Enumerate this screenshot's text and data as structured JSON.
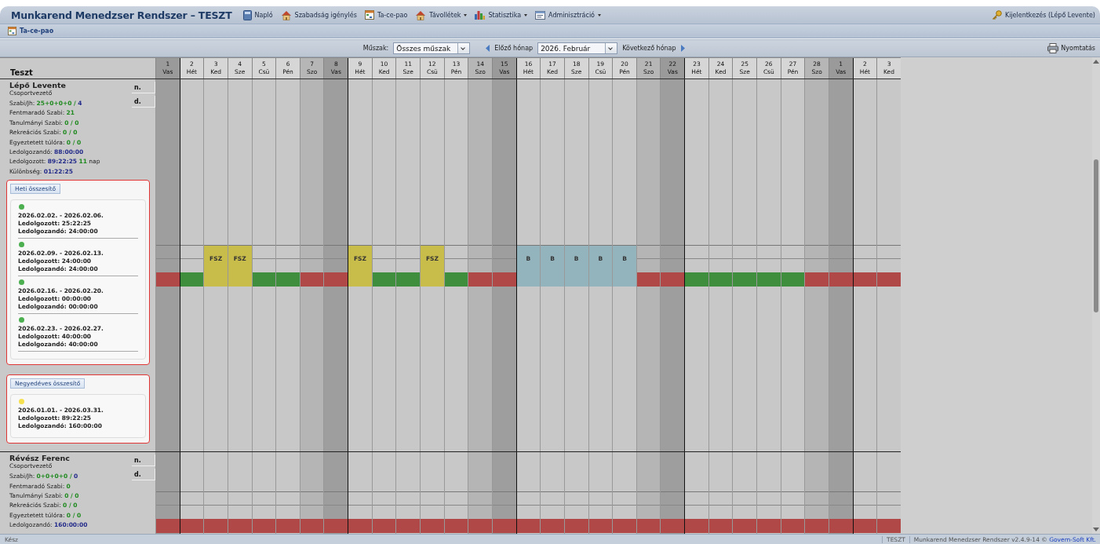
{
  "app_title": "Munkarend Menedzser Rendszer – TESZT",
  "menu": [
    {
      "label": "Napló",
      "dropdown": false
    },
    {
      "label": "Szabadság igénylés",
      "dropdown": false
    },
    {
      "label": "Ta-ce-pao",
      "dropdown": false
    },
    {
      "label": "Távollétek",
      "dropdown": true
    },
    {
      "label": "Statisztika",
      "dropdown": true
    },
    {
      "label": "Adminisztráció",
      "dropdown": true
    }
  ],
  "logout": "Kijelentkezés (Lépő Levente)",
  "tab": "Ta-ce-pao",
  "filters": {
    "shift_label": "Műszak:",
    "shift_value": "Összes műszak",
    "prev": "Előző hónap",
    "month": "2026. Február",
    "next": "Következő hónap",
    "print": "Nyomtatás"
  },
  "grid": {
    "group": "Teszt",
    "days": [
      {
        "num": "1",
        "name": "Vas",
        "kind": "sunday"
      },
      {
        "num": "2",
        "name": "Hét",
        "kind": "weekday"
      },
      {
        "num": "3",
        "name": "Ked",
        "kind": "weekday"
      },
      {
        "num": "4",
        "name": "Sze",
        "kind": "weekday"
      },
      {
        "num": "5",
        "name": "Csü",
        "kind": "weekday"
      },
      {
        "num": "6",
        "name": "Pén",
        "kind": "weekday"
      },
      {
        "num": "7",
        "name": "Szo",
        "kind": "saturday"
      },
      {
        "num": "8",
        "name": "Vas",
        "kind": "sunday"
      },
      {
        "num": "9",
        "name": "Hét",
        "kind": "weekday"
      },
      {
        "num": "10",
        "name": "Ked",
        "kind": "weekday"
      },
      {
        "num": "11",
        "name": "Sze",
        "kind": "weekday"
      },
      {
        "num": "12",
        "name": "Csü",
        "kind": "weekday"
      },
      {
        "num": "13",
        "name": "Pén",
        "kind": "weekday"
      },
      {
        "num": "14",
        "name": "Szo",
        "kind": "saturday"
      },
      {
        "num": "15",
        "name": "Vas",
        "kind": "sunday"
      },
      {
        "num": "16",
        "name": "Hét",
        "kind": "weekday"
      },
      {
        "num": "17",
        "name": "Ked",
        "kind": "weekday"
      },
      {
        "num": "18",
        "name": "Sze",
        "kind": "weekday"
      },
      {
        "num": "19",
        "name": "Csü",
        "kind": "weekday"
      },
      {
        "num": "20",
        "name": "Pén",
        "kind": "weekday"
      },
      {
        "num": "21",
        "name": "Szo",
        "kind": "saturday"
      },
      {
        "num": "22",
        "name": "Vas",
        "kind": "sunday"
      },
      {
        "num": "23",
        "name": "Hét",
        "kind": "weekday"
      },
      {
        "num": "24",
        "name": "Ked",
        "kind": "weekday"
      },
      {
        "num": "25",
        "name": "Sze",
        "kind": "weekday"
      },
      {
        "num": "26",
        "name": "Csü",
        "kind": "weekday"
      },
      {
        "num": "27",
        "name": "Pén",
        "kind": "weekday"
      },
      {
        "num": "28",
        "name": "Szo",
        "kind": "saturday"
      },
      {
        "num": "1",
        "name": "Vas",
        "kind": "sunday"
      },
      {
        "num": "2",
        "name": "Hét",
        "kind": "weekday"
      },
      {
        "num": "3",
        "name": "Ked",
        "kind": "weekday"
      }
    ]
  },
  "employees": [
    {
      "name": "Lépő Levente",
      "role": "Csoportvezető",
      "buttons": [
        "n.",
        "d."
      ],
      "stats": [
        {
          "label": "Szabi/Jh:",
          "parts": [
            {
              "text": "25+0+0+0 /",
              "kind": "green"
            },
            {
              "text": "4",
              "kind": "blue"
            }
          ]
        },
        {
          "label": "Fentmaradó Szabi:",
          "parts": [
            {
              "text": "21",
              "kind": "green"
            }
          ]
        },
        {
          "label": "Tanulmányi Szabi:",
          "parts": [
            {
              "text": "0 / 0",
              "kind": "green"
            }
          ]
        },
        {
          "label": "Rekreációs Szabi:",
          "parts": [
            {
              "text": "0 / 0",
              "kind": "green"
            }
          ]
        },
        {
          "label": "Egyeztetett túlóra:",
          "parts": [
            {
              "text": "0 / 0",
              "kind": "green"
            }
          ]
        },
        {
          "label": "Ledolgozandó:",
          "parts": [
            {
              "text": "88:00:00",
              "kind": "blue"
            }
          ]
        },
        {
          "label": "Ledolgozott:",
          "parts": [
            {
              "text": "89:22:25",
              "kind": "blue"
            },
            {
              "text": "11",
              "kind": "green"
            },
            {
              "text": "nap",
              "kind": "plain"
            }
          ]
        },
        {
          "label": "Különbség:",
          "parts": [
            {
              "text": "01:22:25",
              "kind": "blue"
            }
          ]
        }
      ],
      "summaries": [
        {
          "title": "Heti összesítő",
          "entries": [
            {
              "color": "#4caf50",
              "period": "2026.02.02. - 2026.02.06.",
              "worked": "Ledolgozott: 25:22:25",
              "required": "Ledolgozandó: 24:00:00"
            },
            {
              "color": "#4caf50",
              "period": "2026.02.09. - 2026.02.13.",
              "worked": "Ledolgozott: 24:00:00",
              "required": "Ledolgozandó: 24:00:00"
            },
            {
              "color": "#4caf50",
              "period": "2026.02.16. - 2026.02.20.",
              "worked": "Ledolgozott: 00:00:00",
              "required": "Ledolgozandó: 00:00:00"
            },
            {
              "color": "#4caf50",
              "period": "2026.02.23. - 2026.02.27.",
              "worked": "Ledolgozott: 40:00:00",
              "required": "Ledolgozandó: 40:00:00"
            }
          ]
        },
        {
          "title": "Negyedéves összesítő",
          "entries": [
            {
              "color": "#f5e050",
              "period": "2026.01.01. - 2026.03.31.",
              "worked": "Ledolgozott: 89:22:25",
              "required": "Ledolgozandó: 160:00:00"
            }
          ]
        }
      ],
      "days": [
        {
          "color": "#b04848"
        },
        {
          "color": "#3e8e3e"
        },
        {
          "label": "FSZ",
          "color": "#c8bc4a"
        },
        {
          "label": "FSZ",
          "color": "#c8bc4a"
        },
        {
          "color": "#3e8e3e"
        },
        {
          "color": "#3e8e3e"
        },
        {
          "color": "#b04848"
        },
        {
          "color": "#b04848"
        },
        {
          "label": "FSZ",
          "color": "#c8bc4a"
        },
        {
          "color": "#3e8e3e"
        },
        {
          "color": "#3e8e3e"
        },
        {
          "label": "FSZ",
          "color": "#c8bc4a"
        },
        {
          "color": "#3e8e3e"
        },
        {
          "color": "#b04848"
        },
        {
          "color": "#b04848"
        },
        {
          "label": "B",
          "color": "#93b3bd"
        },
        {
          "label": "B",
          "color": "#93b3bd"
        },
        {
          "label": "B",
          "color": "#93b3bd"
        },
        {
          "label": "B",
          "color": "#93b3bd"
        },
        {
          "label": "B",
          "color": "#93b3bd"
        },
        {
          "color": "#b04848"
        },
        {
          "color": "#b04848"
        },
        {
          "color": "#3e8e3e"
        },
        {
          "color": "#3e8e3e"
        },
        {
          "color": "#3e8e3e"
        },
        {
          "color": "#3e8e3e"
        },
        {
          "color": "#3e8e3e"
        },
        {
          "color": "#b04848"
        },
        {
          "color": "#b04848"
        },
        {
          "color": "#b04848"
        },
        {
          "color": "#b04848"
        }
      ]
    },
    {
      "name": "Révész Ferenc",
      "role": "Csoportvezető",
      "buttons": [
        "n.",
        "d."
      ],
      "stats": [
        {
          "label": "Szabi/Jh:",
          "parts": [
            {
              "text": "0+0+0+0 /",
              "kind": "green"
            },
            {
              "text": "0",
              "kind": "blue"
            }
          ]
        },
        {
          "label": "Fentmaradó Szabi:",
          "parts": [
            {
              "text": "0",
              "kind": "green"
            }
          ]
        },
        {
          "label": "Tanulmányi Szabi:",
          "parts": [
            {
              "text": "0 / 0",
              "kind": "green"
            }
          ]
        },
        {
          "label": "Rekreációs Szabi:",
          "parts": [
            {
              "text": "0 / 0",
              "kind": "green"
            }
          ]
        },
        {
          "label": "Egyeztetett túlóra:",
          "parts": [
            {
              "text": "0 / 0",
              "kind": "green"
            }
          ]
        },
        {
          "label": "Ledolgozandó:",
          "parts": [
            {
              "text": "160:00:00",
              "kind": "blue"
            }
          ]
        }
      ],
      "days": [
        {
          "color": "#b04848"
        },
        {
          "color": "#b04848"
        },
        {
          "color": "#b04848"
        },
        {
          "color": "#b04848"
        },
        {
          "color": "#b04848"
        },
        {
          "color": "#b04848"
        },
        {
          "color": "#b04848"
        },
        {
          "color": "#b04848"
        },
        {
          "color": "#b04848"
        },
        {
          "color": "#b04848"
        },
        {
          "color": "#b04848"
        },
        {
          "color": "#b04848"
        },
        {
          "color": "#b04848"
        },
        {
          "color": "#b04848"
        },
        {
          "color": "#b04848"
        },
        {
          "color": "#b04848"
        },
        {
          "color": "#b04848"
        },
        {
          "color": "#b04848"
        },
        {
          "color": "#b04848"
        },
        {
          "color": "#b04848"
        },
        {
          "color": "#b04848"
        },
        {
          "color": "#b04848"
        },
        {
          "color": "#b04848"
        },
        {
          "color": "#b04848"
        },
        {
          "color": "#b04848"
        },
        {
          "color": "#b04848"
        },
        {
          "color": "#b04848"
        },
        {
          "color": "#b04848"
        },
        {
          "color": "#b04848"
        },
        {
          "color": "#b04848"
        },
        {
          "color": "#b04848"
        }
      ]
    }
  ],
  "status": {
    "left": "Kész",
    "env": "TESZT",
    "version": "Munkarend Menedzser Rendszer v2.4.9-14 ©",
    "link": "Govern-Soft Kft."
  }
}
